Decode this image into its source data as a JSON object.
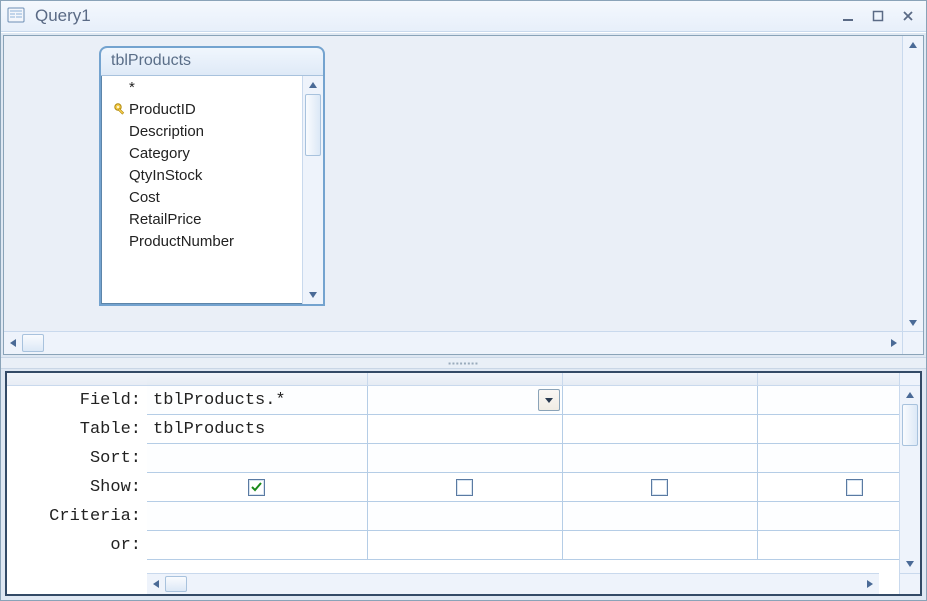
{
  "window": {
    "title": "Query1"
  },
  "source_table": {
    "name": "tblProducts",
    "fields": [
      {
        "name": "*",
        "pk": false
      },
      {
        "name": "ProductID",
        "pk": true
      },
      {
        "name": "Description",
        "pk": false
      },
      {
        "name": "Category",
        "pk": false
      },
      {
        "name": "QtyInStock",
        "pk": false
      },
      {
        "name": "Cost",
        "pk": false
      },
      {
        "name": "RetailPrice",
        "pk": false
      },
      {
        "name": "ProductNumber",
        "pk": false
      }
    ]
  },
  "grid": {
    "row_labels": [
      "Field:",
      "Table:",
      "Sort:",
      "Show:",
      "Criteria:",
      "or:"
    ],
    "columns": [
      {
        "field": "tblProducts.*",
        "table": "tblProducts",
        "sort": "",
        "show": true,
        "criteria": "",
        "or": "",
        "active": true
      },
      {
        "field": "",
        "table": "",
        "sort": "",
        "show": false,
        "criteria": "",
        "or": "",
        "active": false
      },
      {
        "field": "",
        "table": "",
        "sort": "",
        "show": false,
        "criteria": "",
        "or": "",
        "active": false
      },
      {
        "field": "",
        "table": "",
        "sort": "",
        "show": false,
        "criteria": "",
        "or": "",
        "active": false
      }
    ]
  }
}
